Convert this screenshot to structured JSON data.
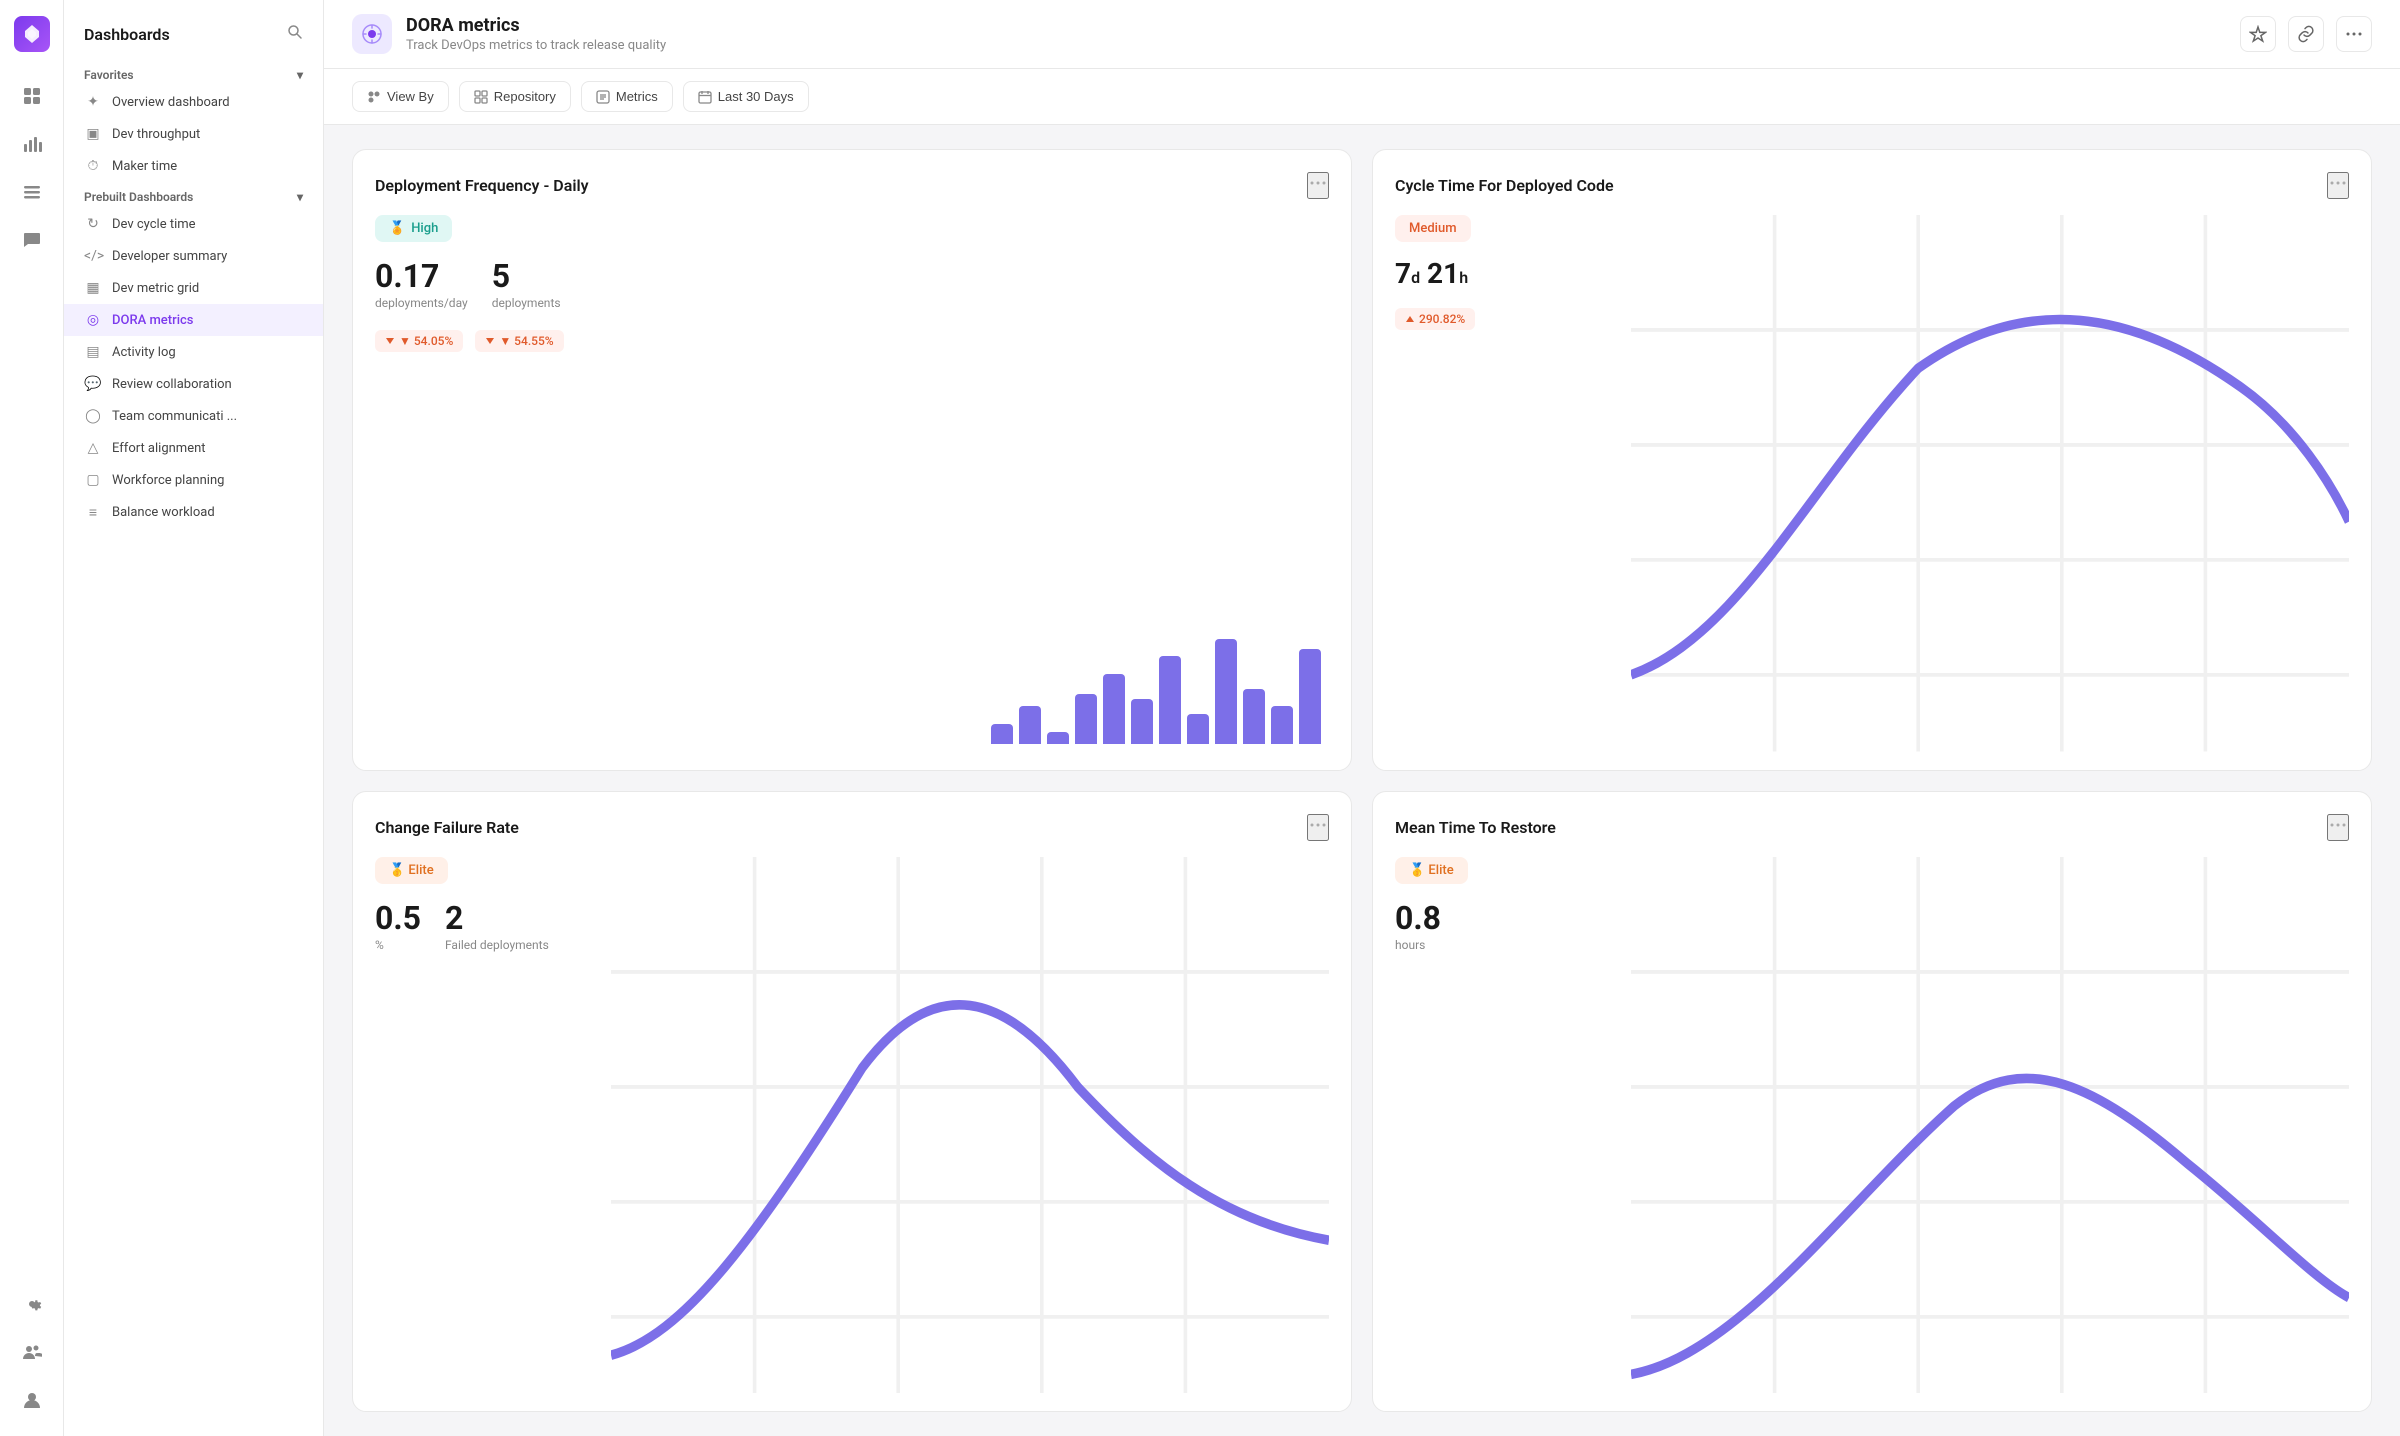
{
  "app": {
    "logo_icon": "◆",
    "title": "Dashboards",
    "search_icon": "🔍"
  },
  "nav_icons": [
    {
      "name": "grid-icon",
      "icon": "⊞",
      "active": false
    },
    {
      "name": "chart-icon",
      "icon": "📊",
      "active": false
    },
    {
      "name": "list-icon",
      "icon": "☰",
      "active": false
    },
    {
      "name": "chat-icon",
      "icon": "💬",
      "active": false
    }
  ],
  "nav_bottom_icons": [
    {
      "name": "settings-icon",
      "icon": "⚙",
      "active": false
    },
    {
      "name": "team-icon",
      "icon": "👥",
      "active": false
    },
    {
      "name": "user-icon",
      "icon": "👤",
      "active": false
    }
  ],
  "sidebar": {
    "favorites_label": "Favorites",
    "favorites_items": [
      {
        "name": "overview-dashboard",
        "icon": "✦",
        "label": "Overview dashboard"
      },
      {
        "name": "dev-throughput",
        "icon": "▣",
        "label": "Dev throughput"
      },
      {
        "name": "maker-time",
        "icon": "⏱",
        "label": "Maker time"
      }
    ],
    "prebuilt_label": "Prebuilt Dashboards",
    "prebuilt_items": [
      {
        "name": "dev-cycle-time",
        "icon": "↻",
        "label": "Dev cycle time"
      },
      {
        "name": "developer-summary",
        "icon": "</>",
        "label": "Developer summary"
      },
      {
        "name": "dev-metric-grid",
        "icon": "▦",
        "label": "Dev metric grid"
      },
      {
        "name": "dora-metrics",
        "icon": "◎",
        "label": "DORA metrics",
        "active": true
      },
      {
        "name": "activity-log",
        "icon": "▤",
        "label": "Activity log"
      },
      {
        "name": "review-collaboration",
        "icon": "💬",
        "label": "Review collaboration"
      },
      {
        "name": "team-communication",
        "icon": "◯",
        "label": "Team communicati ..."
      },
      {
        "name": "effort-alignment",
        "icon": "△",
        "label": "Effort alignment"
      },
      {
        "name": "workforce-planning",
        "icon": "▢",
        "label": "Workforce planning"
      },
      {
        "name": "balance-workload",
        "icon": "≡",
        "label": "Balance workload"
      }
    ]
  },
  "header": {
    "icon": "🔷",
    "title": "DORA metrics",
    "subtitle": "Track DevOps metrics to track release quality",
    "actions": [
      "heart",
      "link",
      "more"
    ]
  },
  "filters": [
    {
      "name": "view-by-filter",
      "icon": "👤",
      "label": "View By"
    },
    {
      "name": "repository-filter",
      "icon": "▦",
      "label": "Repository"
    },
    {
      "name": "metrics-filter",
      "icon": "▣",
      "label": "Metrics"
    },
    {
      "name": "date-filter",
      "icon": "📅",
      "label": "Last 30 Days"
    }
  ],
  "cards": {
    "deployment_frequency": {
      "title": "Deployment Frequency - Daily",
      "badge_text": "🏅 High",
      "badge_type": "high",
      "metric1_value": "0.17",
      "metric1_label": "deployments/day",
      "metric2_value": "5",
      "metric2_label": "deployments",
      "change1": "▼ 54.05%",
      "change1_type": "down",
      "change2": "▼ 54.55%",
      "change2_type": "down",
      "bars": [
        8,
        15,
        5,
        20,
        28,
        18,
        35,
        12,
        42,
        22,
        15,
        38
      ]
    },
    "cycle_time": {
      "title": "Cycle Time For Deployed Code",
      "badge_text": "Medium",
      "badge_type": "medium",
      "metric1_value": "7d 21h",
      "change1": "▲ 290.82%",
      "change1_type": "up"
    },
    "change_failure_rate": {
      "title": "Change Failure Rate",
      "badge_text": "🥇 Elite",
      "badge_type": "elite",
      "metric1_value": "0.5",
      "metric1_label": "%",
      "metric2_value": "2",
      "metric2_label": "Failed deployments"
    },
    "mean_time_restore": {
      "title": "Mean Time To Restore",
      "badge_text": "🥇 Elite",
      "badge_type": "elite",
      "metric1_value": "0.8",
      "metric1_label": "hours"
    }
  }
}
